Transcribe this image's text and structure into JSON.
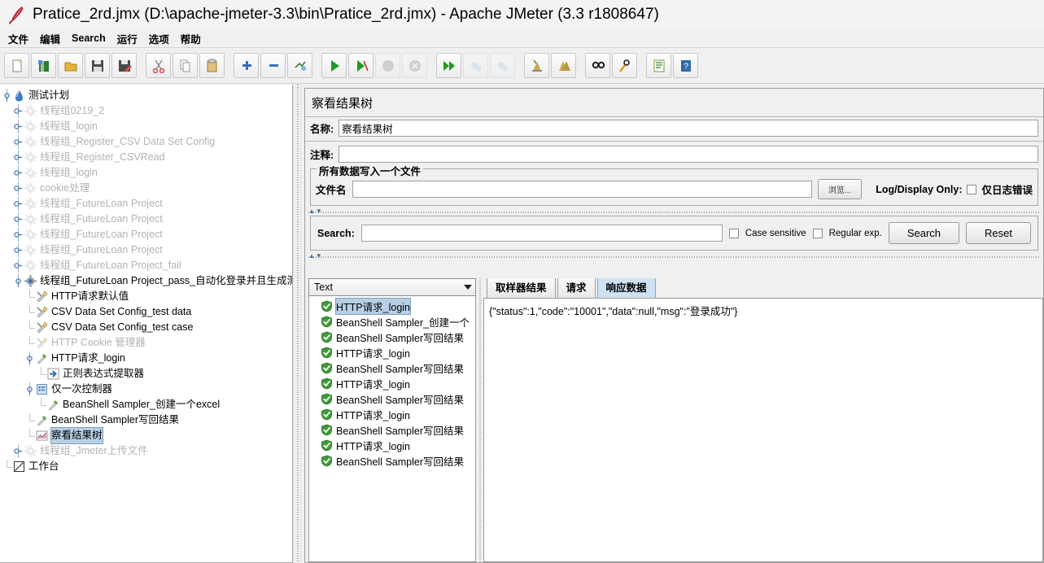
{
  "window": {
    "title": "Pratice_2rd.jmx (D:\\apache-jmeter-3.3\\bin\\Pratice_2rd.jmx) - Apache JMeter (3.3 r1808647)",
    "app_icon": "apache-feather-icon"
  },
  "menubar": {
    "items": [
      {
        "label": "文件",
        "name": "menu-file"
      },
      {
        "label": "编辑",
        "name": "menu-edit"
      },
      {
        "label": "Search",
        "name": "menu-search"
      },
      {
        "label": "运行",
        "name": "menu-run"
      },
      {
        "label": "选项",
        "name": "menu-options"
      },
      {
        "label": "帮助",
        "name": "menu-help"
      }
    ]
  },
  "toolbar": {
    "buttons": [
      {
        "name": "new-icon",
        "enabled": true
      },
      {
        "name": "templates-icon",
        "enabled": true
      },
      {
        "name": "open-icon",
        "enabled": true
      },
      {
        "name": "save-icon",
        "enabled": true
      },
      {
        "name": "save-as-icon",
        "enabled": true
      },
      {
        "name": "separator",
        "enabled": true
      },
      {
        "name": "cut-icon",
        "enabled": true
      },
      {
        "name": "copy-icon",
        "enabled": true
      },
      {
        "name": "paste-icon",
        "enabled": true
      },
      {
        "name": "separator",
        "enabled": true
      },
      {
        "name": "expand-all-icon",
        "enabled": true
      },
      {
        "name": "collapse-all-icon",
        "enabled": true
      },
      {
        "name": "toggle-icon",
        "enabled": true
      },
      {
        "name": "separator",
        "enabled": true
      },
      {
        "name": "start-icon",
        "enabled": true
      },
      {
        "name": "start-no-pauses-icon",
        "enabled": true
      },
      {
        "name": "stop-icon",
        "enabled": false
      },
      {
        "name": "shutdown-icon",
        "enabled": false
      },
      {
        "name": "separator",
        "enabled": true
      },
      {
        "name": "remote-start-all-icon",
        "enabled": true
      },
      {
        "name": "remote-stop-all-icon",
        "enabled": false
      },
      {
        "name": "remote-shutdown-all-icon",
        "enabled": false
      },
      {
        "name": "separator",
        "enabled": true
      },
      {
        "name": "clear-icon",
        "enabled": true
      },
      {
        "name": "clear-all-icon",
        "enabled": true
      },
      {
        "name": "separator",
        "enabled": true
      },
      {
        "name": "search-icon",
        "enabled": true
      },
      {
        "name": "search-reset-icon",
        "enabled": true
      },
      {
        "name": "separator",
        "enabled": true
      },
      {
        "name": "function-helper-icon",
        "enabled": true
      },
      {
        "name": "help-icon",
        "enabled": true
      }
    ]
  },
  "tree": {
    "nodes": [
      {
        "label": "测试计划",
        "indent": 0,
        "icon": "test-plan-icon",
        "handle": "expanded",
        "dim": false,
        "selected": false
      },
      {
        "label": "线程组0219_2",
        "indent": 1,
        "icon": "thread-group-icon",
        "handle": "collapsed",
        "dim": true,
        "selected": false
      },
      {
        "label": "线程组_login",
        "indent": 1,
        "icon": "thread-group-icon",
        "handle": "collapsed",
        "dim": true,
        "selected": false
      },
      {
        "label": "线程组_Register_CSV Data Set Config",
        "indent": 1,
        "icon": "thread-group-icon",
        "handle": "collapsed",
        "dim": true,
        "selected": false
      },
      {
        "label": "线程组_Register_CSVRead",
        "indent": 1,
        "icon": "thread-group-icon",
        "handle": "collapsed",
        "dim": true,
        "selected": false
      },
      {
        "label": "线程组_login",
        "indent": 1,
        "icon": "thread-group-icon",
        "handle": "collapsed",
        "dim": true,
        "selected": false
      },
      {
        "label": "cookie处理",
        "indent": 1,
        "icon": "thread-group-icon",
        "handle": "collapsed",
        "dim": true,
        "selected": false
      },
      {
        "label": "线程组_FutureLoan Project",
        "indent": 1,
        "icon": "thread-group-icon",
        "handle": "collapsed",
        "dim": true,
        "selected": false
      },
      {
        "label": "线程组_FutureLoan Project",
        "indent": 1,
        "icon": "thread-group-icon",
        "handle": "collapsed",
        "dim": true,
        "selected": false
      },
      {
        "label": "线程组_FutureLoan Project",
        "indent": 1,
        "icon": "thread-group-icon",
        "handle": "collapsed",
        "dim": true,
        "selected": false
      },
      {
        "label": "线程组_FutureLoan Project",
        "indent": 1,
        "icon": "thread-group-icon",
        "handle": "collapsed",
        "dim": true,
        "selected": false
      },
      {
        "label": "线程组_FutureLoan Project_fail",
        "indent": 1,
        "icon": "thread-group-icon",
        "handle": "collapsed",
        "dim": true,
        "selected": false
      },
      {
        "label": "线程组_FutureLoan Project_pass_自动化登录并且生成测",
        "indent": 1,
        "icon": "thread-group-icon",
        "handle": "expanded",
        "dim": false,
        "selected": false
      },
      {
        "label": "HTTP请求默认值",
        "indent": 2,
        "icon": "config-element-icon",
        "handle": "leaf",
        "dim": false,
        "selected": false
      },
      {
        "label": "CSV Data Set Config_test data",
        "indent": 2,
        "icon": "config-element-icon",
        "handle": "leaf",
        "dim": false,
        "selected": false
      },
      {
        "label": "CSV Data Set Config_test case",
        "indent": 2,
        "icon": "config-element-icon",
        "handle": "leaf",
        "dim": false,
        "selected": false
      },
      {
        "label": "HTTP Cookie 管理器",
        "indent": 2,
        "icon": "config-element-icon",
        "handle": "leaf",
        "dim": true,
        "selected": false
      },
      {
        "label": "HTTP请求_login",
        "indent": 2,
        "icon": "sampler-icon",
        "handle": "expanded",
        "dim": false,
        "selected": false
      },
      {
        "label": "正则表达式提取器",
        "indent": 3,
        "icon": "post-processor-icon",
        "handle": "leaf",
        "dim": false,
        "selected": false
      },
      {
        "label": "仅一次控制器",
        "indent": 2,
        "icon": "controller-icon",
        "handle": "expanded",
        "dim": false,
        "selected": false
      },
      {
        "label": "BeanShell Sampler_创建一个excel",
        "indent": 3,
        "icon": "sampler-icon",
        "handle": "leaf",
        "dim": false,
        "selected": false
      },
      {
        "label": "BeanShell Sampler写回结果",
        "indent": 2,
        "icon": "sampler-icon",
        "handle": "leaf",
        "dim": false,
        "selected": false
      },
      {
        "label": "察看结果树",
        "indent": 2,
        "icon": "listener-icon",
        "handle": "leaf",
        "dim": false,
        "selected": true
      },
      {
        "label": "线程组_Jmeter上传文件",
        "indent": 1,
        "icon": "thread-group-icon",
        "handle": "collapsed",
        "dim": true,
        "selected": false
      },
      {
        "label": "工作台",
        "indent": 0,
        "icon": "workbench-icon",
        "handle": "leaf",
        "dim": false,
        "selected": false
      }
    ]
  },
  "editor": {
    "panel_title": "察看结果树",
    "name_label": "名称:",
    "name_value": "察看结果树",
    "comment_label": "注释:",
    "comment_value": "",
    "groupbox_title": "所有数据写入一个文件",
    "filename_label": "文件名",
    "filename_value": "",
    "filename_placeholder": "",
    "browse_button": "浏览...",
    "log_display_only_label": "Log/Display Only:",
    "errors_only_label": "仅日志错误",
    "errors_only_checked": false
  },
  "search": {
    "label": "Search:",
    "value": "",
    "placeholder": "",
    "case_sensitive_label": "Case sensitive",
    "case_sensitive_checked": false,
    "regular_exp_label": "Regular exp.",
    "regular_exp_checked": false,
    "search_button": "Search",
    "reset_button": "Reset"
  },
  "results": {
    "renderer_selected": "Text",
    "renderer_options": [
      "Text"
    ],
    "items": [
      {
        "label": "HTTP请求_login",
        "status": "success",
        "selected": true
      },
      {
        "label": "BeanShell Sampler_创建一个",
        "status": "success",
        "selected": false
      },
      {
        "label": "BeanShell Sampler写回结果",
        "status": "success",
        "selected": false
      },
      {
        "label": "HTTP请求_login",
        "status": "success",
        "selected": false
      },
      {
        "label": "BeanShell Sampler写回结果",
        "status": "success",
        "selected": false
      },
      {
        "label": "HTTP请求_login",
        "status": "success",
        "selected": false
      },
      {
        "label": "BeanShell Sampler写回结果",
        "status": "success",
        "selected": false
      },
      {
        "label": "HTTP请求_login",
        "status": "success",
        "selected": false
      },
      {
        "label": "BeanShell Sampler写回结果",
        "status": "success",
        "selected": false
      },
      {
        "label": "HTTP请求_login",
        "status": "success",
        "selected": false
      },
      {
        "label": "BeanShell Sampler写回结果",
        "status": "success",
        "selected": false
      }
    ]
  },
  "detail": {
    "tabs": [
      {
        "label": "取样器结果",
        "active": false
      },
      {
        "label": "请求",
        "active": false
      },
      {
        "label": "响应数据",
        "active": true
      }
    ],
    "response_body": "{\"status\":1,\"code\":\"10001\",\"data\":null,\"msg\":\"登录成功\"}"
  },
  "colors": {
    "selection": "#b8cfe5",
    "active_tab": "#cfe2f3",
    "panel_bg": "#f0f0f0",
    "success_green": "#3e9b37",
    "disabled_text": "#b3b3b3"
  }
}
